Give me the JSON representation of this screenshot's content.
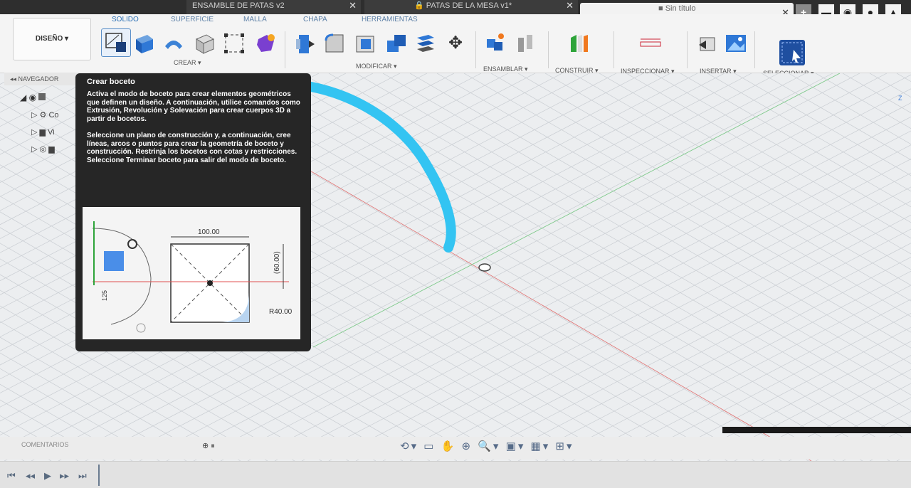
{
  "tabs": [
    {
      "label": "ENSAMBLE DE PATAS v2"
    },
    {
      "label": "PATAS DE LA MESA v1*"
    },
    {
      "label": "Sin título"
    }
  ],
  "workspace": {
    "label": "DISEÑO ▾",
    "tabs": [
      "SOLIDO",
      "SUPERFICIE",
      "MALLA",
      "CHAPA",
      "HERRAMIENTAS"
    ]
  },
  "toolbar_groups": {
    "crear": "CREAR ▾",
    "modificar": "MODIFICAR ▾",
    "ensamblar": "ENSAMBLAR ▾",
    "construir": "CONSTRUIR ▾",
    "inspeccionar": "INSPECCIONAR ▾",
    "insertar": "INSERTAR ▾",
    "seleccionar": "SELECCIONAR ▾"
  },
  "navigator": {
    "label": "NAVEGADOR",
    "rows": [
      "(",
      "Co",
      "Vi"
    ]
  },
  "tooltip": {
    "title": "Crear boceto",
    "para1": "Activa el modo de boceto para crear elementos geométricos que definen un diseño. A continuación, utilice comandos como Extrusión, Revolución y Solevación para crear cuerpos 3D a partir de bocetos.",
    "para2": "Seleccione un plano de construcción y, a continuación, cree líneas, arcos o puntos para crear la geometría de boceto y construcción. Restrinja los bocetos con cotas y restricciones. Seleccione Terminar boceto para salir del modo de boceto.",
    "dim_width": "100.00",
    "dim_height": "(60.00)",
    "dim_radius": "R40.00",
    "dim_side": "125"
  },
  "comments": {
    "label": "COMENTARIOS"
  },
  "viewcube": {
    "z_label": "Z"
  }
}
